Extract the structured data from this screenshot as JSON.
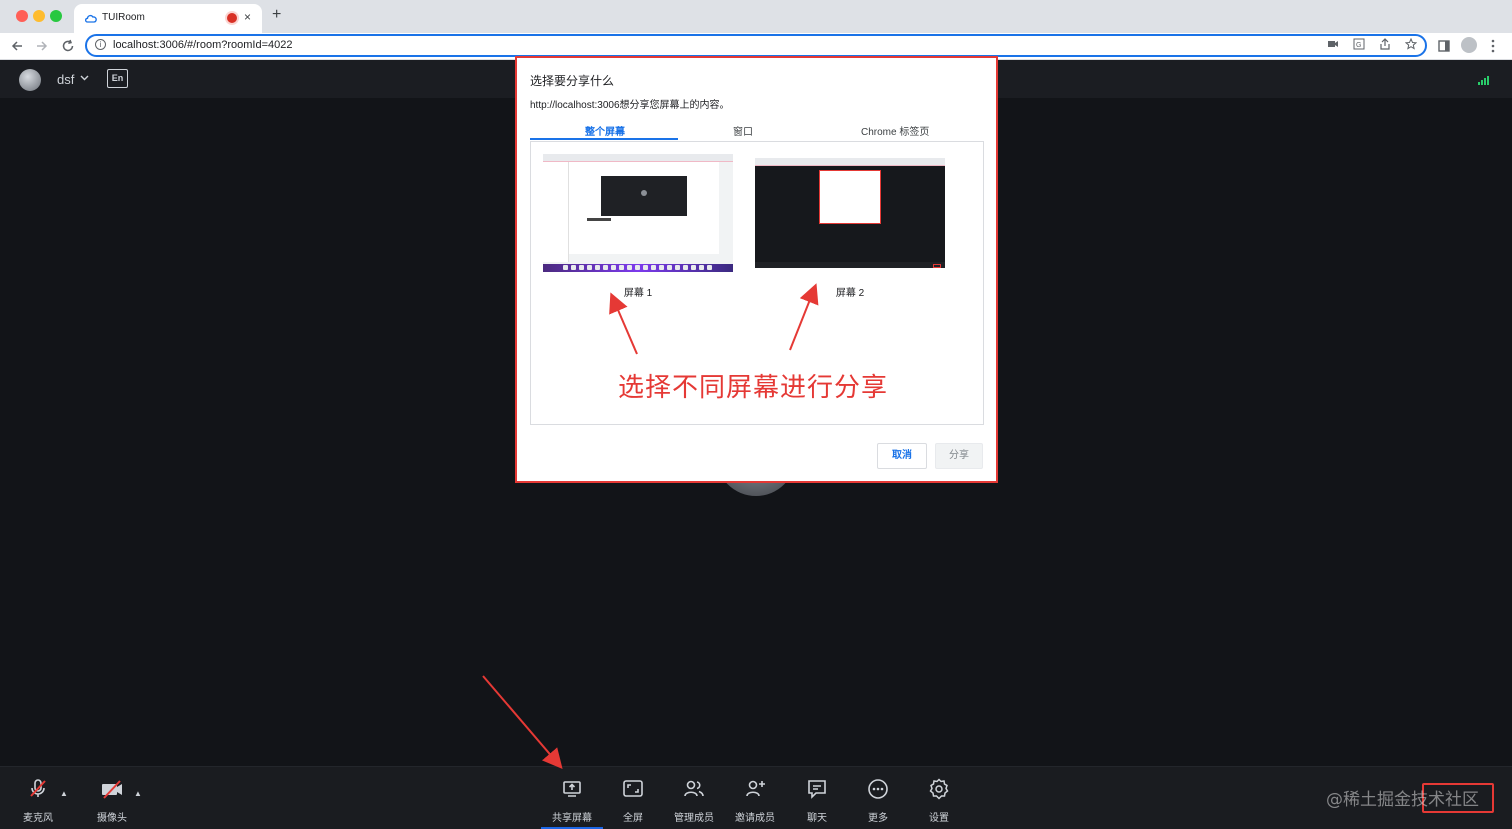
{
  "browser": {
    "tab_title": "TUIRoom",
    "url": "localhost:3006/#/room?roomId=4022",
    "new_tab": "+",
    "close": "×"
  },
  "header": {
    "user_name": "dsf",
    "caret": "⌄",
    "lang_label": "En"
  },
  "dialog": {
    "title": "选择要分享什么",
    "subtitle": "http://localhost:3006想分享您屏幕上的内容。",
    "tabs": [
      {
        "label": "整个屏幕"
      },
      {
        "label": "窗口"
      },
      {
        "label": "Chrome 标签页"
      }
    ],
    "screens": [
      {
        "label": "屏幕 1"
      },
      {
        "label": "屏幕 2"
      }
    ],
    "annotation": "选择不同屏幕进行分享",
    "cancel": "取消",
    "share": "分享"
  },
  "controls": [
    {
      "label": "麦克风",
      "icon": "mic-off-icon"
    },
    {
      "label": "摄像头",
      "icon": "camera-off-icon"
    },
    {
      "label": "共享屏幕",
      "icon": "screen-share-icon"
    },
    {
      "label": "全屏",
      "icon": "fullscreen-icon"
    },
    {
      "label": "管理成员",
      "icon": "members-icon"
    },
    {
      "label": "邀请成员",
      "icon": "invite-icon"
    },
    {
      "label": "聊天",
      "icon": "chat-icon"
    },
    {
      "label": "更多",
      "icon": "more-icon"
    },
    {
      "label": "设置",
      "icon": "settings-icon"
    }
  ],
  "watermark": "@稀土掘金技术社区",
  "colors": {
    "accent": "#1a73e8",
    "annotation": "#e53935",
    "active_tab": "#1c66e5",
    "signal": "#29cc6a"
  }
}
